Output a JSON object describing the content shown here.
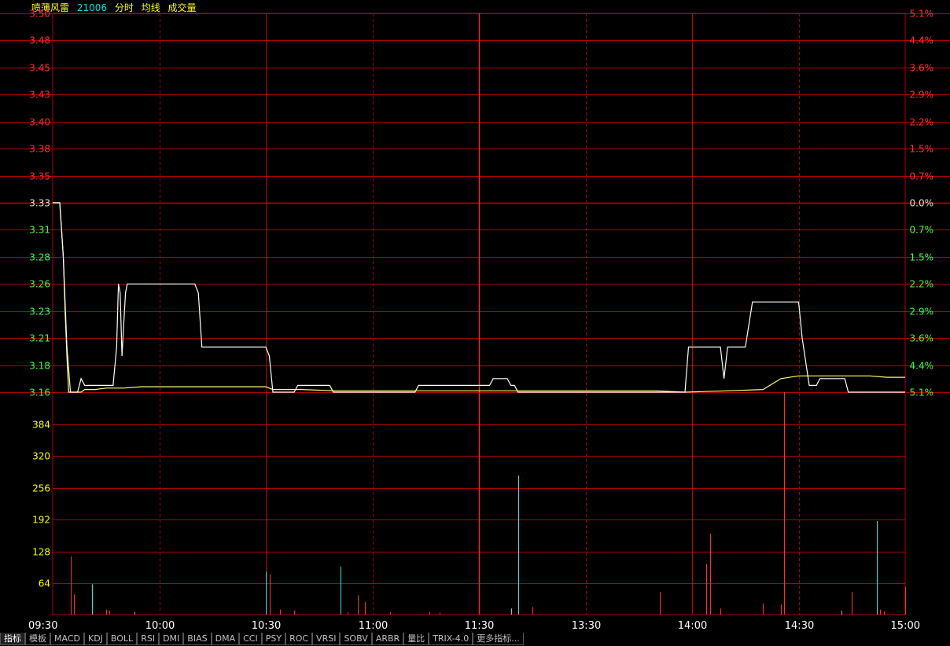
{
  "header": {
    "stock_name": "喷薄风雷",
    "stock_code": "21006",
    "labels": [
      "分时",
      "均线",
      "成交量"
    ]
  },
  "colors": {
    "background": "#000000",
    "grid": "#b00000",
    "grid_major": "#c00000",
    "price_line": "#ffffff",
    "avg_line": "#ffff66",
    "up": "#ff3030",
    "down": "#40ff40",
    "neutral": "#e0e0e0",
    "volume_up": "#ff3030",
    "volume_down": "#40e0e0",
    "axis_time": "#ffffff",
    "volume_axis": "#ffff00"
  },
  "tabs": [
    "指标",
    "模板",
    "MACD",
    "KDJ",
    "BOLL",
    "RSI",
    "DMI",
    "BIAS",
    "DMA",
    "CCI",
    "PSY",
    "ROC",
    "VRSI",
    "SOBV",
    "ARBR",
    "量比",
    "TRIX-4.0",
    "更多指标..."
  ],
  "chart_data": {
    "type": "line",
    "subtype": "intraday-time-sharing",
    "prev_close": 3.33,
    "price_axis": {
      "ticks": [
        3.5,
        3.48,
        3.45,
        3.43,
        3.4,
        3.38,
        3.35,
        3.33,
        3.31,
        3.28,
        3.26,
        3.23,
        3.21,
        3.18,
        3.16
      ],
      "tick_labels": [
        "3.50",
        "3.48",
        "3.45",
        "3.43",
        "3.40",
        "3.38",
        "3.35",
        "3.33",
        "3.31",
        "3.28",
        "3.26",
        "3.23",
        "3.21",
        "3.18",
        "3.16"
      ],
      "ylim": [
        3.16,
        3.5
      ]
    },
    "pct_axis": {
      "tick_labels": [
        "5.1%",
        "4.4%",
        "3.6%",
        "2.9%",
        "2.2%",
        "1.5%",
        "0.7%",
        "0.0%",
        "0.7%",
        "1.5%",
        "2.2%",
        "2.9%",
        "3.6%",
        "4.4%",
        "5.1%"
      ]
    },
    "volume_axis": {
      "tick_labels": [
        "384",
        "320",
        "256",
        "192",
        "128",
        "64"
      ],
      "ticks": [
        384,
        320,
        256,
        192,
        128,
        64
      ],
      "ylim": [
        0,
        440
      ]
    },
    "time_axis": {
      "tick_labels": [
        "09:30",
        "10:00",
        "10:30",
        "11:00",
        "11:30",
        "13:30",
        "14:00",
        "14:30",
        "15:00"
      ],
      "total_minutes": 240
    },
    "price_series": [
      [
        0,
        3.33
      ],
      [
        1,
        3.33
      ],
      [
        2,
        3.33
      ],
      [
        2.5,
        3.31
      ],
      [
        3,
        3.28
      ],
      [
        3.5,
        3.23
      ],
      [
        4,
        3.19
      ],
      [
        4.5,
        3.16
      ],
      [
        5,
        3.16
      ],
      [
        6,
        3.16
      ],
      [
        7,
        3.16
      ],
      [
        8,
        3.17
      ],
      [
        9,
        3.165
      ],
      [
        10,
        3.165
      ],
      [
        12,
        3.165
      ],
      [
        14,
        3.165
      ],
      [
        16,
        3.165
      ],
      [
        17,
        3.165
      ],
      [
        18,
        3.2
      ],
      [
        18.5,
        3.26
      ],
      [
        19,
        3.25
      ],
      [
        19.5,
        3.19
      ],
      [
        20,
        3.22
      ],
      [
        20.5,
        3.25
      ],
      [
        21,
        3.26
      ],
      [
        25,
        3.26
      ],
      [
        30,
        3.26
      ],
      [
        35,
        3.26
      ],
      [
        40,
        3.26
      ],
      [
        41,
        3.25
      ],
      [
        42,
        3.2
      ],
      [
        50,
        3.2
      ],
      [
        55,
        3.2
      ],
      [
        60,
        3.2
      ],
      [
        61,
        3.19
      ],
      [
        62,
        3.16
      ],
      [
        66,
        3.16
      ],
      [
        68,
        3.16
      ],
      [
        69,
        3.165
      ],
      [
        70,
        3.165
      ],
      [
        76,
        3.165
      ],
      [
        78,
        3.165
      ],
      [
        79,
        3.16
      ],
      [
        85,
        3.16
      ],
      [
        95,
        3.16
      ],
      [
        102,
        3.16
      ],
      [
        103,
        3.165
      ],
      [
        110,
        3.165
      ],
      [
        115,
        3.165
      ],
      [
        123,
        3.165
      ],
      [
        124,
        3.17
      ],
      [
        128,
        3.17
      ],
      [
        129,
        3.165
      ],
      [
        130,
        3.165
      ],
      [
        131,
        3.16
      ],
      [
        140,
        3.16
      ],
      [
        150,
        3.16
      ],
      [
        160,
        3.16
      ],
      [
        170,
        3.16
      ],
      [
        175,
        3.16
      ],
      [
        176,
        3.16
      ],
      [
        178,
        3.16
      ],
      [
        179,
        3.2
      ],
      [
        185,
        3.2
      ],
      [
        188,
        3.2
      ],
      [
        189,
        3.17
      ],
      [
        190,
        3.2
      ],
      [
        195,
        3.2
      ],
      [
        196,
        3.22
      ],
      [
        197,
        3.24
      ],
      [
        200,
        3.24
      ],
      [
        205,
        3.24
      ],
      [
        210,
        3.24
      ],
      [
        211,
        3.21
      ],
      [
        213,
        3.165
      ],
      [
        215,
        3.165
      ],
      [
        216,
        3.17
      ],
      [
        220,
        3.17
      ],
      [
        223,
        3.17
      ],
      [
        224,
        3.16
      ],
      [
        230,
        3.16
      ],
      [
        235,
        3.16
      ],
      [
        238,
        3.16
      ],
      [
        240,
        3.16
      ]
    ],
    "avg_series": [
      [
        0,
        3.33
      ],
      [
        1,
        3.33
      ],
      [
        2,
        3.33
      ],
      [
        2.5,
        3.31
      ],
      [
        3,
        3.28
      ],
      [
        4,
        3.2
      ],
      [
        5,
        3.16
      ],
      [
        8,
        3.16
      ],
      [
        9,
        3.162
      ],
      [
        12,
        3.162
      ],
      [
        15,
        3.163
      ],
      [
        20,
        3.163
      ],
      [
        25,
        3.164
      ],
      [
        35,
        3.164
      ],
      [
        45,
        3.164
      ],
      [
        60,
        3.164
      ],
      [
        62,
        3.162
      ],
      [
        70,
        3.162
      ],
      [
        80,
        3.161
      ],
      [
        90,
        3.161
      ],
      [
        100,
        3.161
      ],
      [
        110,
        3.161
      ],
      [
        120,
        3.161
      ],
      [
        130,
        3.161
      ],
      [
        140,
        3.161
      ],
      [
        150,
        3.161
      ],
      [
        160,
        3.161
      ],
      [
        170,
        3.161
      ],
      [
        178,
        3.16
      ],
      [
        190,
        3.161
      ],
      [
        200,
        3.162
      ],
      [
        205,
        3.17
      ],
      [
        210,
        3.172
      ],
      [
        220,
        3.172
      ],
      [
        230,
        3.172
      ],
      [
        235,
        3.171
      ],
      [
        240,
        3.171
      ]
    ],
    "volume_bars": [
      [
        5,
        115,
        "up"
      ],
      [
        6,
        40,
        "up"
      ],
      [
        11,
        60,
        "down"
      ],
      [
        15,
        10,
        "up"
      ],
      [
        16,
        8,
        "up"
      ],
      [
        23,
        5,
        "down"
      ],
      [
        60,
        85,
        "down"
      ],
      [
        61,
        80,
        "up"
      ],
      [
        64,
        10,
        "up"
      ],
      [
        68,
        8,
        "up"
      ],
      [
        81,
        95,
        "down"
      ],
      [
        83,
        5,
        "up"
      ],
      [
        86,
        38,
        "up"
      ],
      [
        88,
        25,
        "up"
      ],
      [
        95,
        5,
        "up"
      ],
      [
        106,
        6,
        "up"
      ],
      [
        109,
        4,
        "up"
      ],
      [
        129,
        12,
        "down"
      ],
      [
        131,
        275,
        "down"
      ],
      [
        135,
        15,
        "up"
      ],
      [
        171,
        45,
        "up"
      ],
      [
        184,
        100,
        "up"
      ],
      [
        185,
        160,
        "up"
      ],
      [
        188,
        12,
        "up"
      ],
      [
        200,
        22,
        "up"
      ],
      [
        205,
        20,
        "up"
      ],
      [
        206,
        440,
        "up"
      ],
      [
        222,
        8,
        "down"
      ],
      [
        225,
        45,
        "up"
      ],
      [
        232,
        185,
        "down"
      ],
      [
        233,
        10,
        "up"
      ],
      [
        234,
        6,
        "up"
      ],
      [
        240,
        55,
        "up"
      ]
    ]
  }
}
